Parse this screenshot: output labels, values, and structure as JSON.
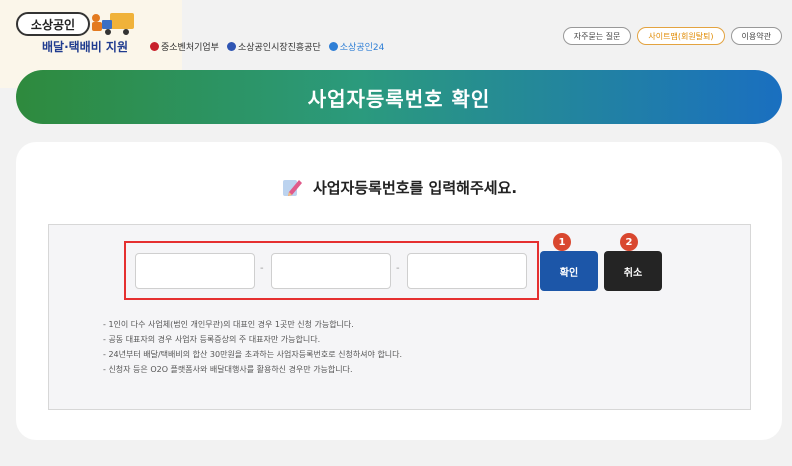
{
  "header": {
    "logo_top": "소상공인",
    "logo_sub": "배달·택배비 지원",
    "orgs": [
      {
        "label": "중소벤처기업부",
        "color": "#c8202a"
      },
      {
        "label": "소상공인시장진흥공단",
        "color": "#2f55b3"
      },
      {
        "label": "소상공인24",
        "color": "#2f7fd6"
      }
    ],
    "links": [
      "자주묻는 질문",
      "사이트맵(회원탈퇴)",
      "이용약관"
    ]
  },
  "banner": {
    "title": "사업자등록번호 확인"
  },
  "form": {
    "prompt": "사업자등록번호를 입력해주세요.",
    "separator": "-",
    "confirm_label": "확인",
    "cancel_label": "취소",
    "badge_confirm": "1",
    "badge_cancel": "2",
    "field1_value": "",
    "field2_value": "",
    "field3_value": ""
  },
  "notes": [
    "1인이 다수 사업체(법인 개인무관)의 대표인 경우 1곳만 신청 가능합니다.",
    "공동 대표자의 경우 사업자 등록증상의 주 대표자만 가능합니다.",
    "24년부터 배달/택배비의 합산 30만원을 초과하는 사업자등록번호로 신청하셔야 합니다.",
    "신청자 등은 O2O 플랫폼사와 배달대행사를 활용하신 경우만 가능합니다."
  ],
  "colors": {
    "banner_start": "#2e8a3d",
    "banner_end": "#1a6fc0",
    "confirm_button": "#1c56a8",
    "cancel_button": "#242424",
    "highlight_frame": "#e53030",
    "badge": "#d9472f"
  }
}
